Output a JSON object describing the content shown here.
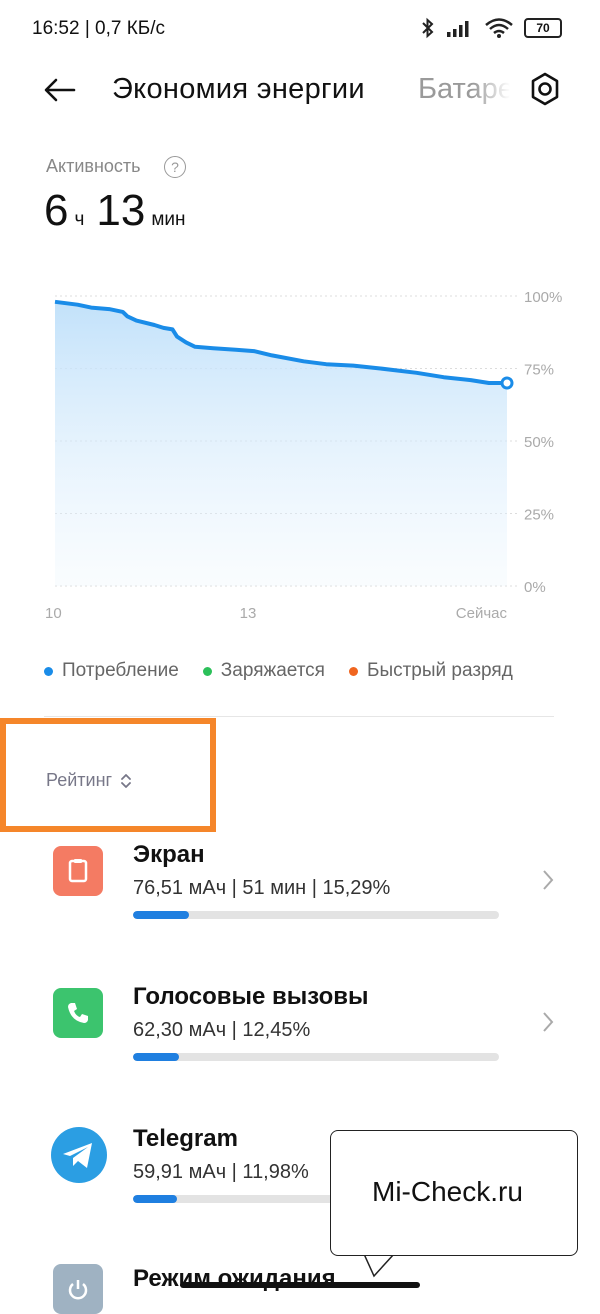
{
  "status": {
    "time": "16:52 | 0,7 КБ/с",
    "battery": "70"
  },
  "header": {
    "title": "Экономия энергии",
    "tab_next": "Батарея"
  },
  "activity": {
    "label": "Активность",
    "hours": "6",
    "hours_unit": "ч",
    "minutes": "13",
    "minutes_unit": "мин"
  },
  "chart_data": {
    "type": "area",
    "x_tick_labels": [
      "10",
      "13",
      "Сейчас"
    ],
    "y_tick_labels": [
      "100%",
      "75%",
      "50%",
      "25%",
      "0%"
    ],
    "ylim": [
      0,
      100
    ],
    "points": [
      {
        "t": 0.0,
        "v": 98
      },
      {
        "t": 0.05,
        "v": 97
      },
      {
        "t": 0.08,
        "v": 96
      },
      {
        "t": 0.12,
        "v": 95.5
      },
      {
        "t": 0.15,
        "v": 94.5
      },
      {
        "t": 0.16,
        "v": 93
      },
      {
        "t": 0.18,
        "v": 91.5
      },
      {
        "t": 0.22,
        "v": 90
      },
      {
        "t": 0.24,
        "v": 89
      },
      {
        "t": 0.26,
        "v": 88.5
      },
      {
        "t": 0.27,
        "v": 86
      },
      {
        "t": 0.29,
        "v": 84
      },
      {
        "t": 0.31,
        "v": 82.5
      },
      {
        "t": 0.35,
        "v": 82
      },
      {
        "t": 0.4,
        "v": 81.5
      },
      {
        "t": 0.44,
        "v": 81
      },
      {
        "t": 0.48,
        "v": 79.5
      },
      {
        "t": 0.55,
        "v": 77.5
      },
      {
        "t": 0.6,
        "v": 76.5
      },
      {
        "t": 0.66,
        "v": 76
      },
      {
        "t": 0.72,
        "v": 75
      },
      {
        "t": 0.8,
        "v": 73.5
      },
      {
        "t": 0.86,
        "v": 72
      },
      {
        "t": 0.92,
        "v": 71
      },
      {
        "t": 0.96,
        "v": 70
      },
      {
        "t": 1.0,
        "v": 70
      }
    ],
    "line_color": "#1a8ce8",
    "fill_color": "#cfe8fb"
  },
  "legend": [
    {
      "label": "Потребление",
      "color": "#1a8ce8"
    },
    {
      "label": "Заряжается",
      "color": "#2cc05a"
    },
    {
      "label": "Быстрый разряд",
      "color": "#f0651f"
    }
  ],
  "sort": {
    "label": "Рейтинг"
  },
  "items": [
    {
      "title": "Экран",
      "details": "76,51 мАч | 51 мин  | 15,29%",
      "percent": 15.29,
      "icon": "screen-icon",
      "icon_color": "#f47b63"
    },
    {
      "title": "Голосовые вызовы",
      "details": "62,30 мАч | 12,45%",
      "percent": 12.45,
      "icon": "phone-icon",
      "icon_color": "#3cc46e"
    },
    {
      "title": "Telegram",
      "details": "59,91 мАч | 11,98%",
      "percent": 11.98,
      "icon": "telegram-icon",
      "icon_color": "#2b9ee3"
    },
    {
      "title": "Режим ожидания",
      "icon": "power-icon",
      "icon_color": "#9fb2c2"
    }
  ],
  "watermark": {
    "text": "Mi-Check.ru"
  }
}
